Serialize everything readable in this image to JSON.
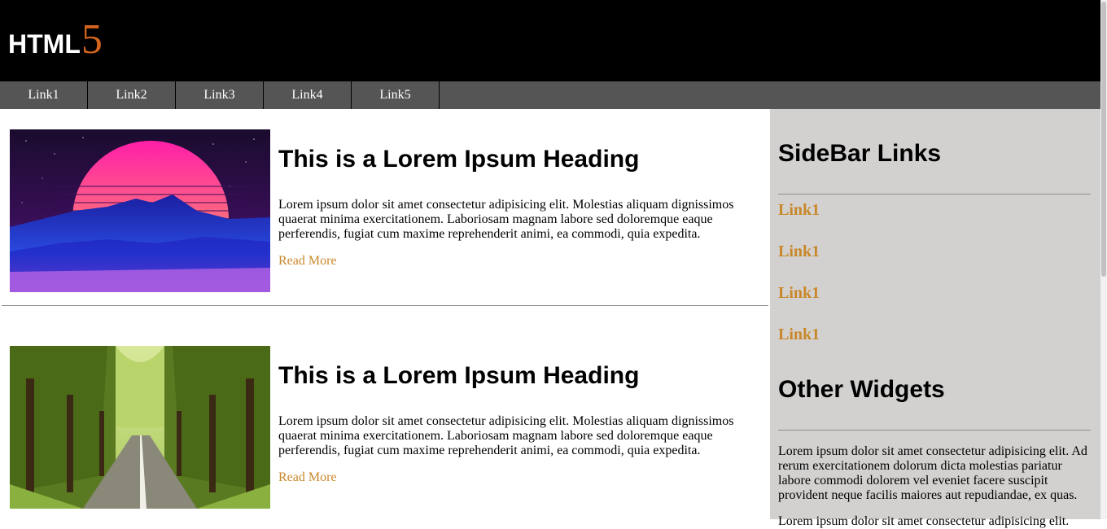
{
  "logo": {
    "text": "HTML",
    "number": "5"
  },
  "nav": {
    "links": [
      "Link1",
      "Link2",
      "Link3",
      "Link4",
      "Link5"
    ]
  },
  "articles": [
    {
      "heading": "This is a Lorem Ipsum Heading",
      "body": "Lorem ipsum dolor sit amet consectetur adipisicing elit. Molestias aliquam dignissimos quaerat minima exercitationem. Laboriosam magnam labore sed doloremque eaque perferendis, fugiat cum maxime reprehenderit animi, ea commodi, quia expedita.",
      "read_more": "Read More"
    },
    {
      "heading": "This is a Lorem Ipsum Heading",
      "body": "Lorem ipsum dolor sit amet consectetur adipisicing elit. Molestias aliquam dignissimos quaerat minima exercitationem. Laboriosam magnam labore sed doloremque eaque perferendis, fugiat cum maxime reprehenderit animi, ea commodi, quia expedita.",
      "read_more": "Read More"
    }
  ],
  "sidebar": {
    "links_heading": "SideBar Links",
    "links": [
      "Link1",
      "Link1",
      "Link1",
      "Link1"
    ],
    "widgets_heading": "Other Widgets",
    "widget_text": "Lorem ipsum dolor sit amet consectetur adipisicing elit. Ad rerum exercitationem dolorum dicta molestias pariatur labore commodi dolorem vel eveniet facere suscipit provident neque facilis maiores aut repudiandae, ex quas.",
    "widget_text_2": "Lorem ipsum dolor sit amet consectetur adipisicing elit."
  },
  "colors": {
    "header_bg": "#000000",
    "nav_bg": "#555555",
    "accent": "#c8882a",
    "logo_accent": "#d2641e",
    "sidebar_bg": "#d3d1d0"
  }
}
